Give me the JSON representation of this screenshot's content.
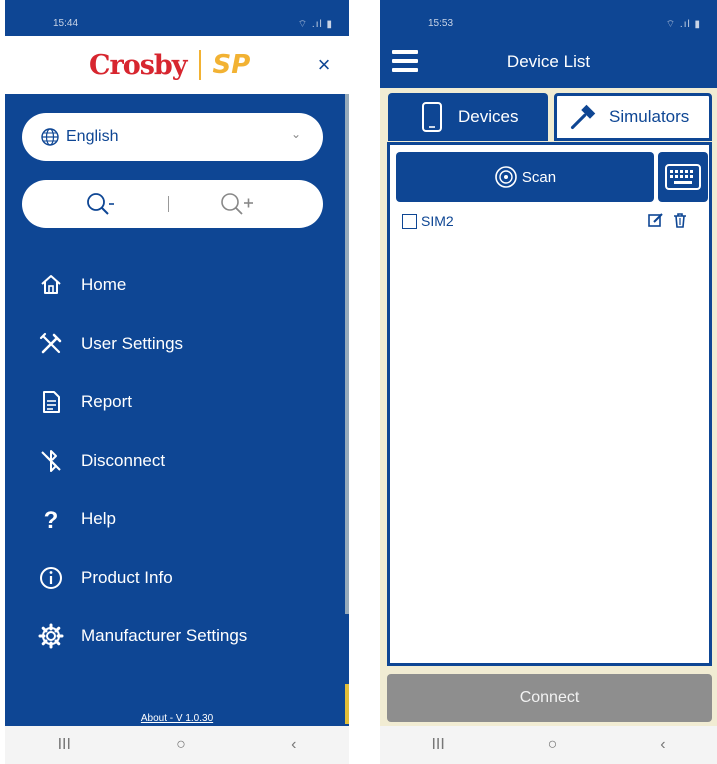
{
  "left_screen": {
    "status": {
      "time": "15:44",
      "icons": "⌔ .ıl ▮"
    },
    "logo": {
      "brand": "Crosby",
      "sub_brand": "SP"
    },
    "close_icon": "×",
    "language": {
      "value": "English",
      "icon": "globe-icon"
    },
    "zoom": {
      "out_icon": "zoom-out-icon",
      "in_icon": "zoom-in-icon"
    },
    "menu": [
      {
        "label": "Home",
        "icon": "home-icon"
      },
      {
        "label": "User Settings",
        "icon": "tools-icon"
      },
      {
        "label": "Report",
        "icon": "document-icon"
      },
      {
        "label": "Disconnect",
        "icon": "bluetooth-off-icon"
      },
      {
        "label": "Help",
        "icon": "question-icon"
      },
      {
        "label": "Product Info",
        "icon": "info-icon"
      },
      {
        "label": "Manufacturer Settings",
        "icon": "gear-icon"
      }
    ],
    "about": "About - V 1.0.30",
    "nav": {
      "recent": "III",
      "home": "○",
      "back": "‹"
    }
  },
  "right_screen": {
    "status": {
      "time": "15:53",
      "icons": "⌔ .ıl ▮"
    },
    "title": "Device List",
    "tabs": [
      {
        "label": "Devices",
        "icon": "phone-icon",
        "active": true
      },
      {
        "label": "Simulators",
        "icon": "hammer-icon",
        "active": false
      }
    ],
    "scan_label": "Scan",
    "devices": [
      {
        "name": "SIM2",
        "checked": false
      }
    ],
    "connect_label": "Connect",
    "nav": {
      "recent": "III",
      "home": "○",
      "back": "‹"
    }
  },
  "colors": {
    "primary": "#0e4694",
    "brand_red": "#d7262f",
    "brand_yellow": "#f2b233",
    "disabled": "#8e8e8e",
    "background_cream": "#f1ecd3"
  }
}
